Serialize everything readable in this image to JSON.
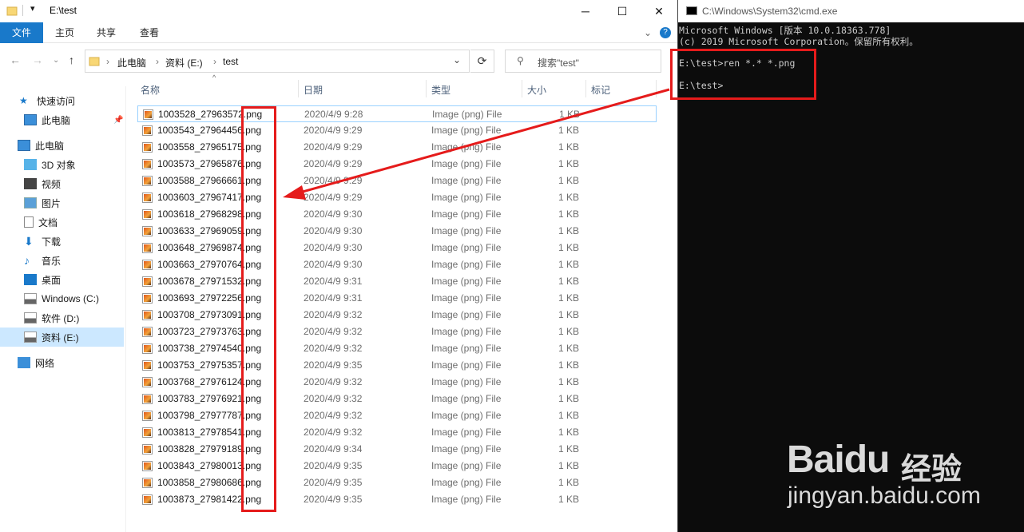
{
  "explorer": {
    "title": "E:\\test",
    "ribbon_tabs": [
      "文件",
      "主页",
      "共享",
      "查看"
    ],
    "breadcrumb": [
      "此电脑",
      "资料 (E:)",
      "test"
    ],
    "search_placeholder": "搜索\"test\"",
    "nav": {
      "quick_access": "快速访问",
      "quick_this_pc": "此电脑",
      "this_pc": "此电脑",
      "items": [
        "3D 对象",
        "视频",
        "图片",
        "文档",
        "下载",
        "音乐",
        "桌面",
        "Windows (C:)",
        "软件 (D:)",
        "资料 (E:)"
      ],
      "network": "网络"
    },
    "columns": [
      "名称",
      "日期",
      "类型",
      "大小",
      "标记"
    ],
    "files": [
      {
        "name": "1003528_27963572.png",
        "date": "2020/4/9 9:28",
        "type": "Image (png) File",
        "size": "1 KB"
      },
      {
        "name": "1003543_27964456.png",
        "date": "2020/4/9 9:29",
        "type": "Image (png) File",
        "size": "1 KB"
      },
      {
        "name": "1003558_27965175.png",
        "date": "2020/4/9 9:29",
        "type": "Image (png) File",
        "size": "1 KB"
      },
      {
        "name": "1003573_27965876.png",
        "date": "2020/4/9 9:29",
        "type": "Image (png) File",
        "size": "1 KB"
      },
      {
        "name": "1003588_27966661.png",
        "date": "2020/4/9 9:29",
        "type": "Image (png) File",
        "size": "1 KB"
      },
      {
        "name": "1003603_27967417.png",
        "date": "2020/4/9 9:29",
        "type": "Image (png) File",
        "size": "1 KB"
      },
      {
        "name": "1003618_27968298.png",
        "date": "2020/4/9 9:30",
        "type": "Image (png) File",
        "size": "1 KB"
      },
      {
        "name": "1003633_27969059.png",
        "date": "2020/4/9 9:30",
        "type": "Image (png) File",
        "size": "1 KB"
      },
      {
        "name": "1003648_27969874.png",
        "date": "2020/4/9 9:30",
        "type": "Image (png) File",
        "size": "1 KB"
      },
      {
        "name": "1003663_27970764.png",
        "date": "2020/4/9 9:30",
        "type": "Image (png) File",
        "size": "1 KB"
      },
      {
        "name": "1003678_27971532.png",
        "date": "2020/4/9 9:31",
        "type": "Image (png) File",
        "size": "1 KB"
      },
      {
        "name": "1003693_27972256.png",
        "date": "2020/4/9 9:31",
        "type": "Image (png) File",
        "size": "1 KB"
      },
      {
        "name": "1003708_27973091.png",
        "date": "2020/4/9 9:32",
        "type": "Image (png) File",
        "size": "1 KB"
      },
      {
        "name": "1003723_27973763.png",
        "date": "2020/4/9 9:32",
        "type": "Image (png) File",
        "size": "1 KB"
      },
      {
        "name": "1003738_27974540.png",
        "date": "2020/4/9 9:32",
        "type": "Image (png) File",
        "size": "1 KB"
      },
      {
        "name": "1003753_27975357.png",
        "date": "2020/4/9 9:35",
        "type": "Image (png) File",
        "size": "1 KB"
      },
      {
        "name": "1003768_27976124.png",
        "date": "2020/4/9 9:32",
        "type": "Image (png) File",
        "size": "1 KB"
      },
      {
        "name": "1003783_27976921.png",
        "date": "2020/4/9 9:32",
        "type": "Image (png) File",
        "size": "1 KB"
      },
      {
        "name": "1003798_27977787.png",
        "date": "2020/4/9 9:32",
        "type": "Image (png) File",
        "size": "1 KB"
      },
      {
        "name": "1003813_27978541.png",
        "date": "2020/4/9 9:32",
        "type": "Image (png) File",
        "size": "1 KB"
      },
      {
        "name": "1003828_27979189.png",
        "date": "2020/4/9 9:34",
        "type": "Image (png) File",
        "size": "1 KB"
      },
      {
        "name": "1003843_27980013.png",
        "date": "2020/4/9 9:35",
        "type": "Image (png) File",
        "size": "1 KB"
      },
      {
        "name": "1003858_27980686.png",
        "date": "2020/4/9 9:35",
        "type": "Image (png) File",
        "size": "1 KB"
      },
      {
        "name": "1003873_27981422.png",
        "date": "2020/4/9 9:35",
        "type": "Image (png) File",
        "size": "1 KB"
      }
    ]
  },
  "cmd": {
    "title": "C:\\Windows\\System32\\cmd.exe",
    "lines": [
      "Microsoft Windows [版本 10.0.18363.778]",
      "(c) 2019 Microsoft Corporation。保留所有权利。",
      "",
      "E:\\test>ren *.* *.png",
      "",
      "E:\\test>"
    ]
  },
  "watermark": {
    "brand": "Baidu",
    "cn": "经验",
    "url": "jingyan.baidu.com"
  },
  "colors": {
    "ribbon_file_tab": "#1979ca",
    "selection": "#cce8ff",
    "annotation_red": "#e51b1b",
    "cmd_bg": "#0c0c0c"
  }
}
